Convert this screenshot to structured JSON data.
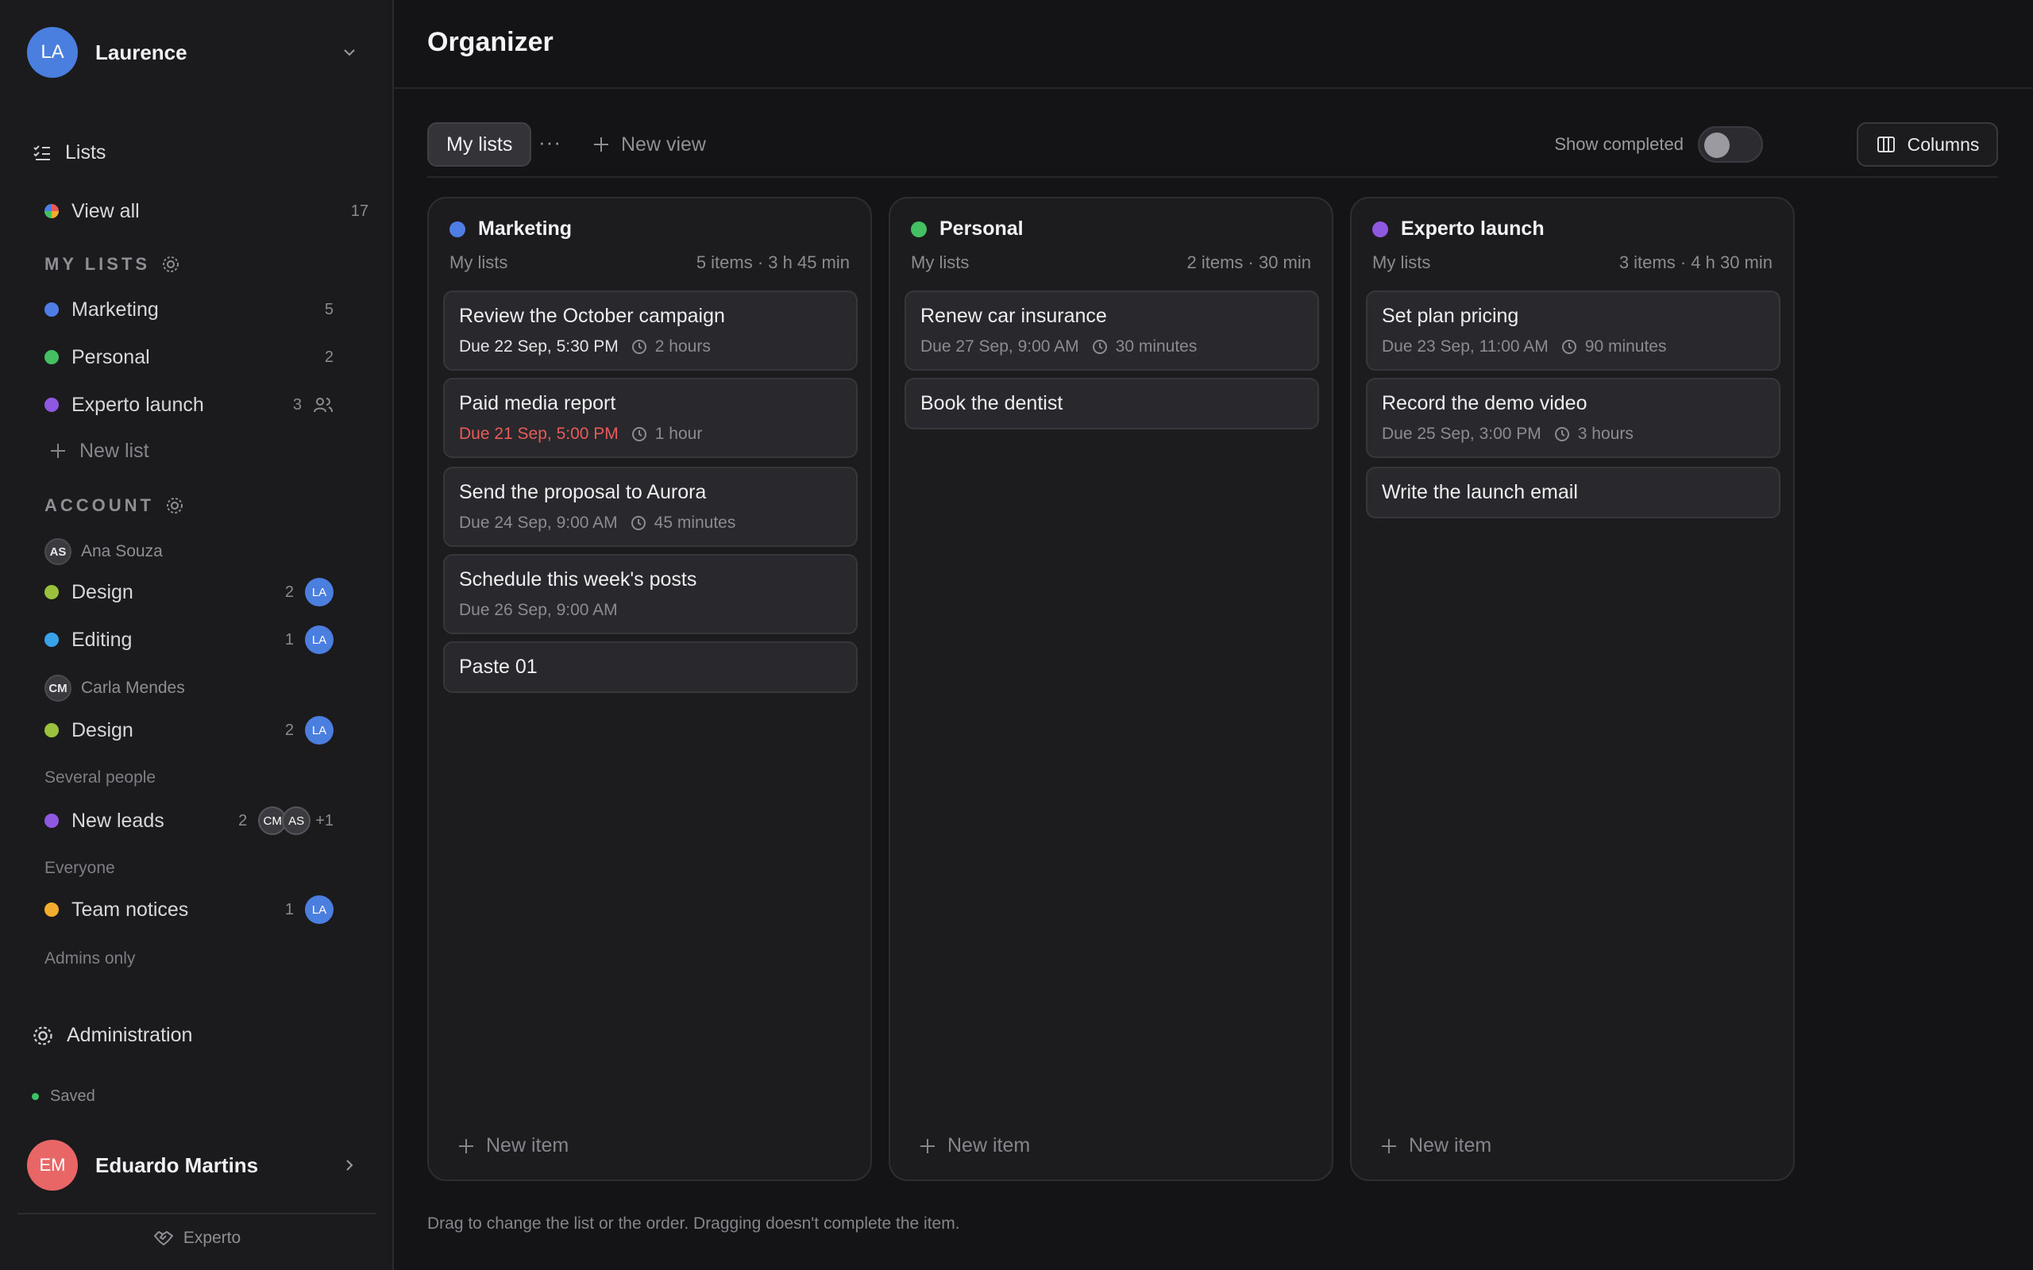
{
  "workspace": {
    "initials": "LA",
    "name": "Laurence"
  },
  "nav": {
    "lists": "Lists",
    "view_all": "View all",
    "view_all_count": "17"
  },
  "my_lists": {
    "label": "MY LISTS",
    "items": [
      {
        "label": "Marketing",
        "count": "5",
        "color": "#4f7de6"
      },
      {
        "label": "Personal",
        "count": "2",
        "color": "#44c062"
      },
      {
        "label": "Experto launch",
        "count": "3",
        "color": "#8e58e0"
      }
    ],
    "new_list": "New list"
  },
  "account": {
    "label": "ACCOUNT",
    "ana": {
      "initials": "AS",
      "name": "Ana Souza"
    },
    "ana_lists": [
      {
        "label": "Design",
        "count": "2",
        "avatar": "LA",
        "color": "#9ac23c"
      },
      {
        "label": "Editing",
        "count": "1",
        "avatar": "LA",
        "color": "#38a3e8"
      }
    ],
    "carla": {
      "initials": "CM",
      "name": "Carla Mendes"
    },
    "carla_lists": [
      {
        "label": "Design",
        "count": "2",
        "avatar": "LA",
        "color": "#9ac23c"
      }
    ],
    "several_label": "Several people",
    "new_leads": {
      "label": "New leads",
      "count": "2",
      "av1": "CM",
      "av2": "AS",
      "more": "+1",
      "color": "#8e58e0"
    },
    "everyone_label": "Everyone",
    "team_notices": {
      "label": "Team notices",
      "count": "1",
      "avatar": "LA",
      "color": "#f0ae2c"
    },
    "admins_label": "Admins only"
  },
  "administration": "Administration",
  "status": "Saved",
  "user": {
    "initials": "EM",
    "name": "Eduardo Martins"
  },
  "brand": "Experto",
  "page_title": "Organizer",
  "toolbar": {
    "tab": "My lists",
    "more": "···",
    "new_view": "New view",
    "show_completed": "Show completed",
    "columns": "Columns"
  },
  "columns": [
    {
      "title": "Marketing",
      "color": "#4f7de6",
      "sub": "My lists",
      "summary": "5 items · 3 h 45 min",
      "cards": [
        {
          "title": "Review the October campaign",
          "due": "Due 22 Sep, 5:30 PM",
          "duration": "2 hours",
          "due_style": "bright"
        },
        {
          "title": "Paid media report",
          "due": "Due 21 Sep, 5:00 PM",
          "duration": "1 hour",
          "due_style": "overdue"
        },
        {
          "title": "Send the proposal to Aurora",
          "due": "Due 24 Sep, 9:00 AM",
          "duration": "45 minutes",
          "due_style": "normal"
        },
        {
          "title": "Schedule this week's posts",
          "due": "Due 26 Sep, 9:00 AM",
          "duration": "",
          "due_style": "normal"
        },
        {
          "title": "Paste 01",
          "due": "",
          "duration": "",
          "due_style": "normal"
        }
      ],
      "new_item": "New item"
    },
    {
      "title": "Personal",
      "color": "#44c062",
      "sub": "My lists",
      "summary": "2 items · 30 min",
      "cards": [
        {
          "title": "Renew car insurance",
          "due": "Due 27 Sep, 9:00 AM",
          "duration": "30 minutes",
          "due_style": "normal"
        },
        {
          "title": "Book the dentist",
          "due": "",
          "duration": "",
          "due_style": "normal"
        }
      ],
      "new_item": "New item"
    },
    {
      "title": "Experto launch",
      "color": "#8e58e0",
      "sub": "My lists",
      "summary": "3 items · 4 h 30 min",
      "cards": [
        {
          "title": "Set plan pricing",
          "due": "Due 23 Sep, 11:00 AM",
          "duration": "90 minutes",
          "due_style": "normal"
        },
        {
          "title": "Record the demo video",
          "due": "Due 25 Sep, 3:00 PM",
          "duration": "3 hours",
          "due_style": "normal"
        },
        {
          "title": "Write the launch email",
          "due": "",
          "duration": "",
          "due_style": "normal"
        }
      ],
      "new_item": "New item"
    }
  ],
  "footer_hint": "Drag to change the list or the order. Dragging doesn't complete the item."
}
